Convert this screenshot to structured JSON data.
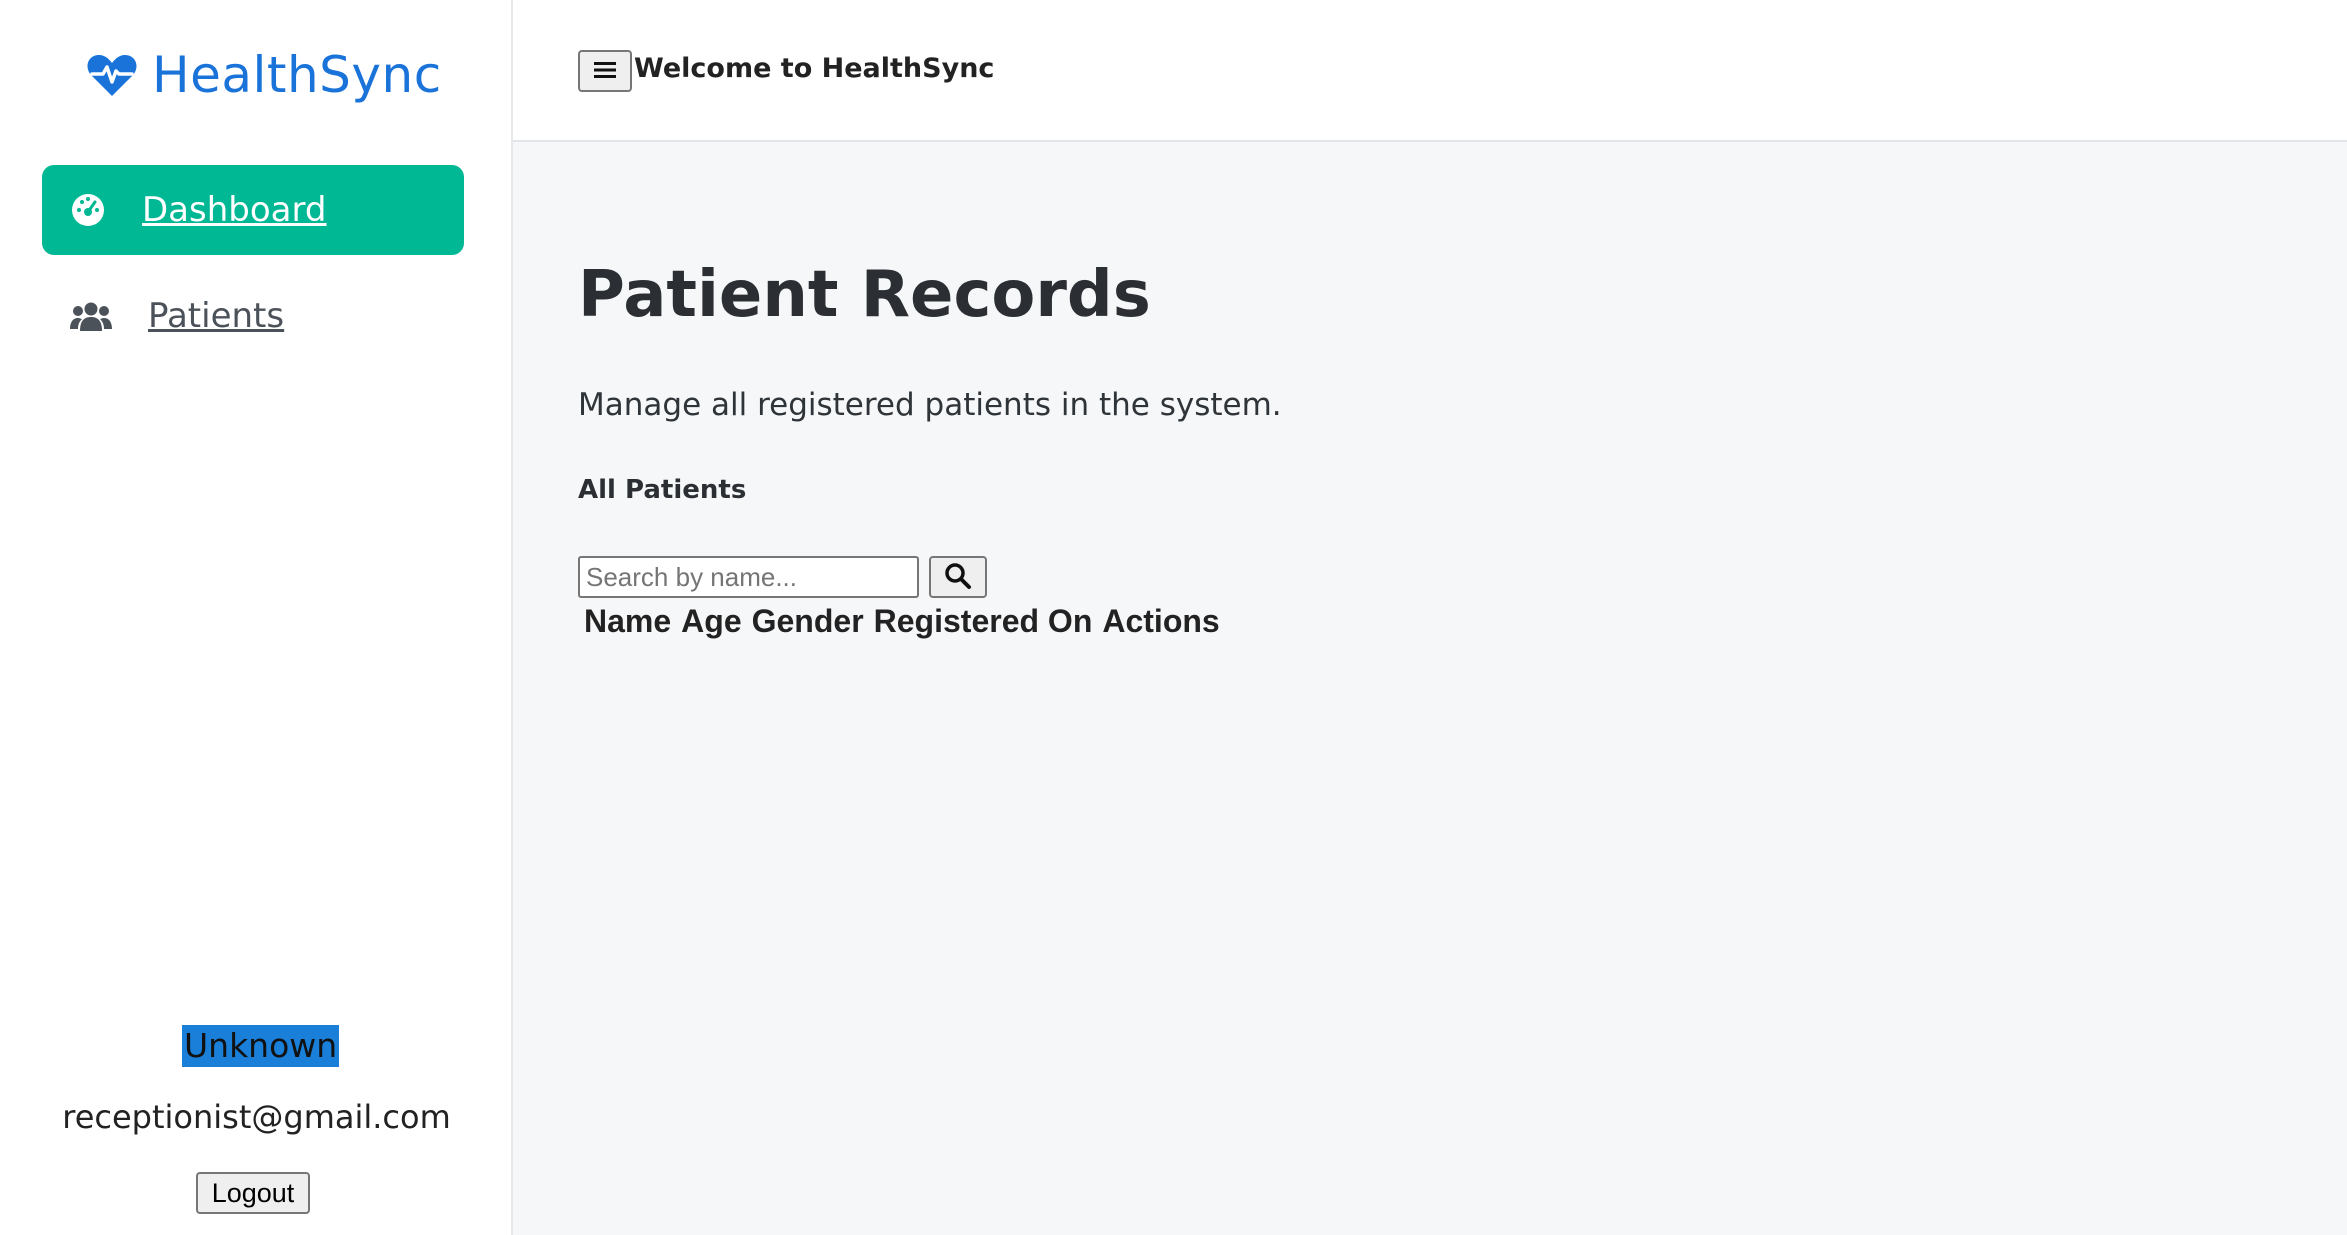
{
  "brand": {
    "name": "HealthSync",
    "icon": "heart-pulse-icon",
    "color": "#1a73d9"
  },
  "sidebar": {
    "items": [
      {
        "label": "Dashboard",
        "icon": "gauge-icon",
        "active": true
      },
      {
        "label": "Patients",
        "icon": "users-icon",
        "active": false
      }
    ],
    "accent_color": "#00b894"
  },
  "user": {
    "name": "Unknown",
    "email": "receptionist@gmail.com",
    "logout_label": "Logout"
  },
  "header": {
    "menu_icon": "hamburger-icon",
    "welcome": "Welcome to HealthSync"
  },
  "main": {
    "title": "Patient Records",
    "subtitle": "Manage all registered patients in the system.",
    "section_title": "All Patients",
    "search": {
      "placeholder": "Search by name...",
      "value": "",
      "button_icon": "search-icon"
    },
    "table": {
      "columns": [
        "Name",
        "Age",
        "Gender",
        "Registered On",
        "Actions"
      ],
      "rows": []
    }
  }
}
